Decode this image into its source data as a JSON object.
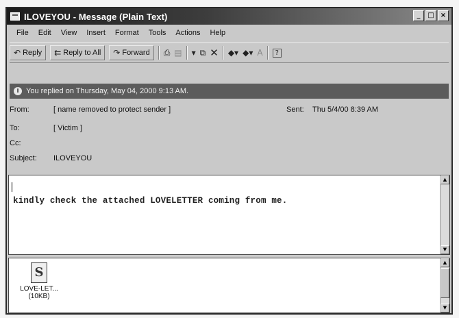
{
  "window": {
    "title": "ILOVEYOU - Message (Plain Text)",
    "controls": {
      "minimize": "_",
      "maximize": "□",
      "close": "×"
    }
  },
  "menu": [
    "File",
    "Edit",
    "View",
    "Insert",
    "Format",
    "Tools",
    "Actions",
    "Help"
  ],
  "toolbar": {
    "reply": "Reply",
    "reply_all": "Reply to All",
    "forward": "Forward"
  },
  "info_bar": {
    "text": "You replied on Thursday, May 04, 2000 9:13 AM."
  },
  "header": {
    "from_label": "From:",
    "from_value": "[ name removed to protect sender ]",
    "sent_label": "Sent:",
    "sent_value": "Thu 5/4/00 8:39 AM",
    "to_label": "To:",
    "to_value": "[ Victim ]",
    "cc_label": "Cc:",
    "cc_value": "",
    "subject_label": "Subject:",
    "subject_value": "ILOVEYOU"
  },
  "body": {
    "text": "kindly check the attached LOVELETTER coming from me."
  },
  "attachment": {
    "name": "LOVE-LET...",
    "size": "(10KB)"
  },
  "icons": [
    "window-icon",
    "reply-icon",
    "reply-all-icon",
    "forward-icon",
    "print-icon",
    "flag-icon",
    "move-icon",
    "delete-icon",
    "previous-icon",
    "next-icon",
    "address-book-icon",
    "help-icon",
    "info-icon",
    "script-file-icon"
  ]
}
